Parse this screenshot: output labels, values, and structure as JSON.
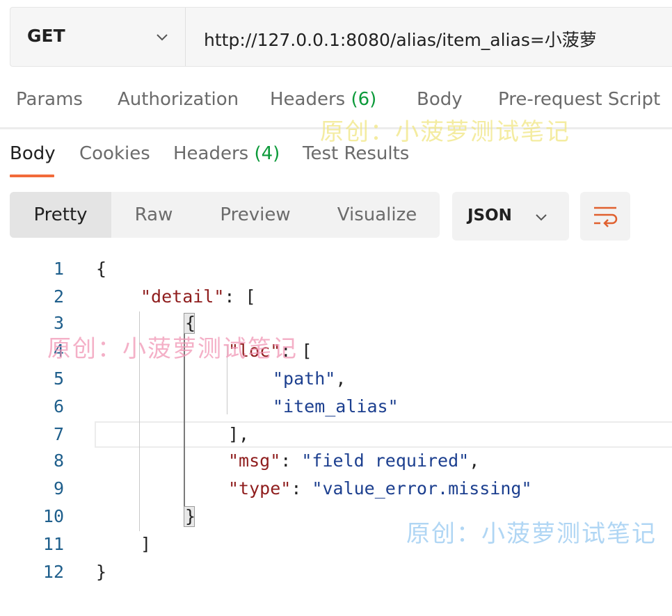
{
  "request": {
    "method": "GET",
    "url": "http://127.0.0.1:8080/alias/item_alias=小菠萝"
  },
  "request_tabs": {
    "params": "Params",
    "authorization": "Authorization",
    "headers_label": "Headers",
    "headers_count": "(6)",
    "body": "Body",
    "pre_request": "Pre-request Script"
  },
  "response_tabs": {
    "body": "Body",
    "cookies": "Cookies",
    "headers_label": "Headers",
    "headers_count": "(4)",
    "test_results": "Test Results"
  },
  "view_modes": {
    "pretty": "Pretty",
    "raw": "Raw",
    "preview": "Preview",
    "visualize": "Visualize"
  },
  "format": {
    "selected": "JSON"
  },
  "code": {
    "line_numbers": [
      "1",
      "2",
      "3",
      "4",
      "5",
      "6",
      "7",
      "8",
      "9",
      "10",
      "11",
      "12"
    ],
    "l1": "{",
    "l2_key": "\"detail\"",
    "l2_rest": ": [",
    "l3": "{",
    "l4_key": "\"loc\"",
    "l4_rest": ": [",
    "l5_str": "\"path\"",
    "l5_rest": ",",
    "l6_str": "\"item_alias\"",
    "l7": "],",
    "l8_key": "\"msg\"",
    "l8_sep": ": ",
    "l8_str": "\"field required\"",
    "l8_rest": ",",
    "l9_key": "\"type\"",
    "l9_sep": ": ",
    "l9_str": "\"value_error.missing\"",
    "l10": "}",
    "l11": "]",
    "l12": "}"
  },
  "watermark": "原创：小菠萝测试笔记",
  "colors": {
    "accent": "#f26b3a",
    "count_green": "#0c9a3a",
    "json_key": "#8f1d1d",
    "json_string": "#1c3f8f"
  }
}
